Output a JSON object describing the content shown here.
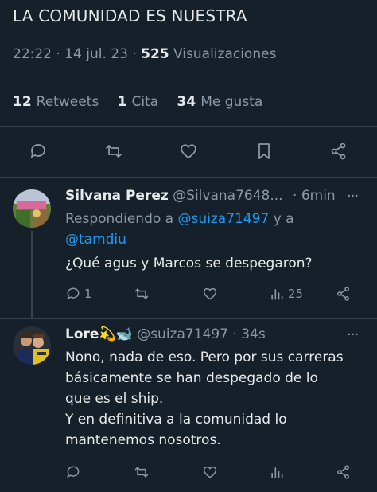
{
  "tweet": {
    "text": "LA COMUNIDAD ES NUESTRA",
    "time": "22:22",
    "date": "14 jul. 23",
    "views_count": "525",
    "views_label": "Visualizaciones",
    "retweets_count": "12",
    "retweets_label": "Retweets",
    "quotes_count": "1",
    "quotes_label": "Cita",
    "likes_count": "34",
    "likes_label": "Me gusta",
    "separator": "·"
  },
  "replies": [
    {
      "name": "Silvana Perez",
      "handle": "@Silvana7648...",
      "time": "6min",
      "replying_prefix": "Respondiendo a",
      "replying_to_1": "@suiza71497",
      "replying_and": "y a",
      "replying_to_2": "@tamdiu",
      "text": "¿Qué agus y Marcos se despegaron?",
      "reply_count": "1",
      "views_count": "25",
      "more": "···"
    },
    {
      "name": "Lore",
      "name_emoji": "💫🐋",
      "handle": "@suiza71497",
      "time": "34s",
      "text_lines": [
        "Nono, nada de eso. Pero por sus carreras",
        "básicamente se han despegado de lo",
        "que es el ship.",
        "Y en definitiva a la comunidad lo",
        "mantenemos nosotros."
      ],
      "more": "···"
    }
  ],
  "icons": {
    "reply": "reply-icon",
    "retweet": "retweet-icon",
    "like": "heart-icon",
    "bookmark": "bookmark-icon",
    "share": "share-icon",
    "views": "views-icon"
  },
  "colors": {
    "background": "#15202b",
    "text": "#e7e9ea",
    "muted": "#8b98a5",
    "link": "#1d9bf0",
    "divider": "#38444d"
  }
}
